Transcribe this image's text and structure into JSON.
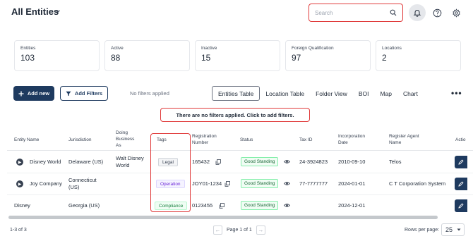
{
  "header": {
    "title": "All Entities",
    "search_placeholder": "Search"
  },
  "stats": [
    {
      "label": "Entities",
      "value": "103"
    },
    {
      "label": "Active",
      "value": "88"
    },
    {
      "label": "Inactive",
      "value": "15"
    },
    {
      "label": "Foreign Qualification",
      "value": "97"
    },
    {
      "label": "Locations",
      "value": "2"
    }
  ],
  "toolbar": {
    "add_label": "Add new",
    "filters_label": "Add Filters",
    "filter_status": "No filters applied",
    "views": [
      "Entities Table",
      "Location Table",
      "Folder View",
      "BOI",
      "Map",
      "Chart"
    ],
    "active_view": "Entities Table"
  },
  "banner": "There are no filters applied. Click to add filters.",
  "table": {
    "headers": {
      "entity_name": "Entity Name",
      "jurisdiction": "Jurisdiction",
      "dba_1": "Doing",
      "dba_2": "Business",
      "dba_3": "As",
      "tags": "Tags",
      "reg_1": "Registration",
      "reg_2": "Number",
      "status": "Status",
      "tax_id": "Tax ID",
      "inc_1": "Incorporation",
      "inc_2": "Date",
      "agent_1": "Register Agent",
      "agent_2": "Name",
      "actions": "Actio"
    },
    "rows": [
      {
        "name": "Disney World",
        "jurisdiction_1": "Delaware (US)",
        "jurisdiction_2": "",
        "dba_1": "Walt Disney",
        "dba_2": "World",
        "tag": "Legal",
        "registration": "165432",
        "status": "Good Standing",
        "tax_id": "24-3924823",
        "incorporation": "2010-09-10",
        "agent": "Telos"
      },
      {
        "name": "Joy Company",
        "jurisdiction_1": "Connecticut",
        "jurisdiction_2": "(US)",
        "dba_1": "",
        "dba_2": "",
        "tag": "Operation",
        "registration": "JOY01-1234",
        "status": "Good Standing",
        "tax_id": "77-7777777",
        "incorporation": "2024-01-01",
        "agent": "C T Corporation System"
      },
      {
        "name": "Disney",
        "jurisdiction_1": "Georgia (US)",
        "jurisdiction_2": "",
        "dba_1": "",
        "dba_2": "",
        "tag": "Compliance",
        "registration": "0123455",
        "status": "Good Standing",
        "tax_id": "",
        "incorporation": "2024-12-01",
        "agent": ""
      }
    ]
  },
  "footer": {
    "count": "1-3 of 3",
    "page_label": "Page 1 of 1",
    "rows_per_page_label": "Rows per page:",
    "rows_per_page": "25"
  },
  "colors": {
    "primary": "#1e3a5f",
    "highlight": "#e03b3b",
    "good_standing": "#166534"
  }
}
